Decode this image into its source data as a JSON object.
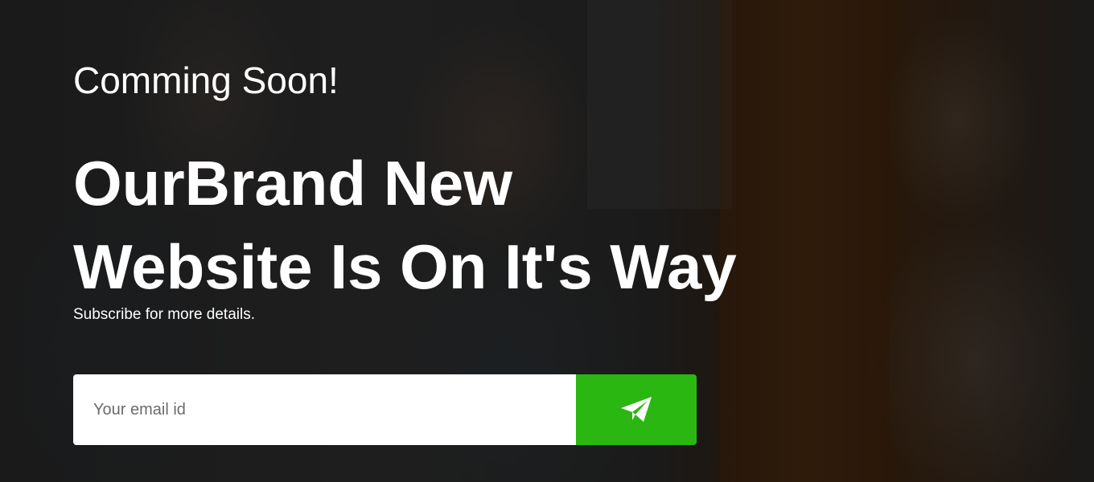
{
  "hero": {
    "subtitle": "Comming Soon!",
    "headline_line1": "OurBrand New",
    "headline_line2": "Website Is On It's Way",
    "tagline": "Subscribe for more details."
  },
  "subscribe": {
    "email_placeholder": "Your email id",
    "email_value": "",
    "submit_icon": "paper-plane-icon"
  },
  "colors": {
    "button_bg": "#2ab712",
    "text": "#ffffff",
    "overlay": "rgba(0,0,0,0.55)"
  }
}
